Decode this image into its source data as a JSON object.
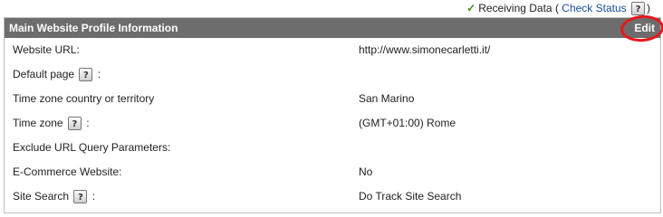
{
  "status": {
    "text": "Receiving Data",
    "open_paren": "(",
    "link": "Check Status",
    "close_paren": ")",
    "icon": "checkmark-icon",
    "icon_color": "#3f8f1f"
  },
  "panel": {
    "title": "Main Website Profile Information",
    "edit_label": "Edit",
    "header_color": "#6d6d6d",
    "highlight_color": "#e8161a",
    "help_glyph": "?",
    "rows": [
      {
        "label": "Website URL:",
        "suffix": "",
        "value": "http://www.simonecarletti.it/"
      },
      {
        "label": "Default page",
        "suffix": ":",
        "value": ""
      },
      {
        "label": "Time zone country or territory",
        "suffix": "",
        "value": "San Marino"
      },
      {
        "label": "Time zone",
        "suffix": ":",
        "value": "(GMT+01:00) Rome"
      },
      {
        "label": "Exclude URL Query Parameters:",
        "suffix": "",
        "value": ""
      },
      {
        "label": "E-Commerce Website:",
        "suffix": "",
        "value": "No"
      },
      {
        "label": "Site Search",
        "suffix": ":",
        "value": "Do Track Site Search"
      }
    ]
  }
}
